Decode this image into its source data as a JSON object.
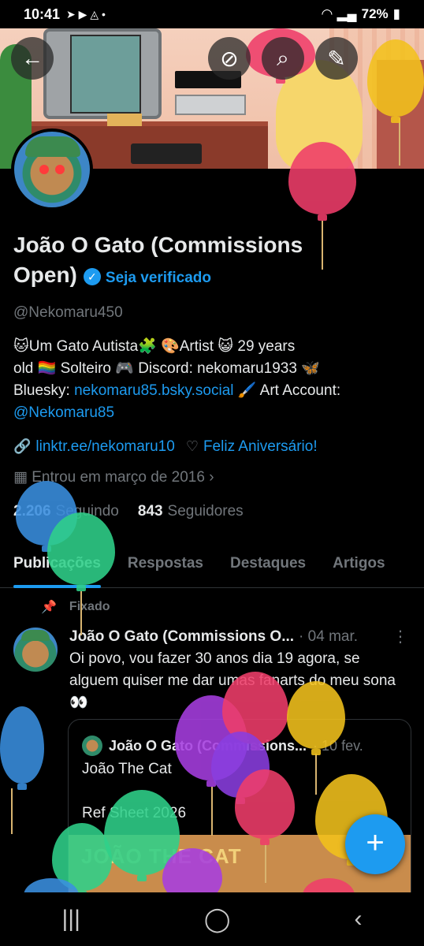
{
  "status": {
    "time": "10:41",
    "battery": "72%",
    "extra": "Vo) LTE"
  },
  "profile": {
    "name": "João O Gato (Commissions Open)",
    "verify_label": "Seja verificado",
    "handle": "@Nekomaru450",
    "bio_line1": "🐱Um Gato Autista🧩 🎨Artist 😺 29 years",
    "bio_line2": "old 🏳️‍🌈 Solteiro 🎮 Discord: nekomaru1933 🦋",
    "bio_line3_prefix": "Bluesky: ",
    "bio_bluesky": "nekomaru85.bsky.social",
    "bio_line3_suffix": " 🖌️ Art Account:",
    "bio_art_account": "@Nekomaru85",
    "link": "linktr.ee/nekomaru10",
    "birthday": "Feliz Aniversário!",
    "joined": "Entrou em março de 2016",
    "following_count": "2.206",
    "following_label": "Seguindo",
    "followers_count": "843",
    "followers_label": "Seguidores"
  },
  "tabs": [
    {
      "label": "Publicações"
    },
    {
      "label": "Respostas"
    },
    {
      "label": "Destaques"
    },
    {
      "label": "Artigos"
    }
  ],
  "post": {
    "pinned_label": "Fixado",
    "author": "João O Gato (Commissions O...",
    "date": "· 04 mar.",
    "text": "Oi povo, vou fazer 30 anos dia 19 agora, se alguem quiser me dar umas fanarts do meu sona 👀",
    "quote": {
      "author": "João O Gato (Commissions...",
      "date": "· 10 fev.",
      "line1": "João The Cat",
      "line2": "Ref Sheet 2026",
      "image_title": "JOÃO THE CAT"
    }
  },
  "colors": {
    "accent": "#1d9bf0",
    "background": "#000000",
    "muted": "#71767b"
  },
  "icons": [
    "back-icon",
    "hide-icon",
    "search-icon",
    "edit-icon",
    "link-icon",
    "balloon-icon",
    "calendar-icon",
    "pin-icon",
    "more-icon",
    "compose-icon",
    "recents-icon",
    "home-icon",
    "back-nav-icon"
  ]
}
